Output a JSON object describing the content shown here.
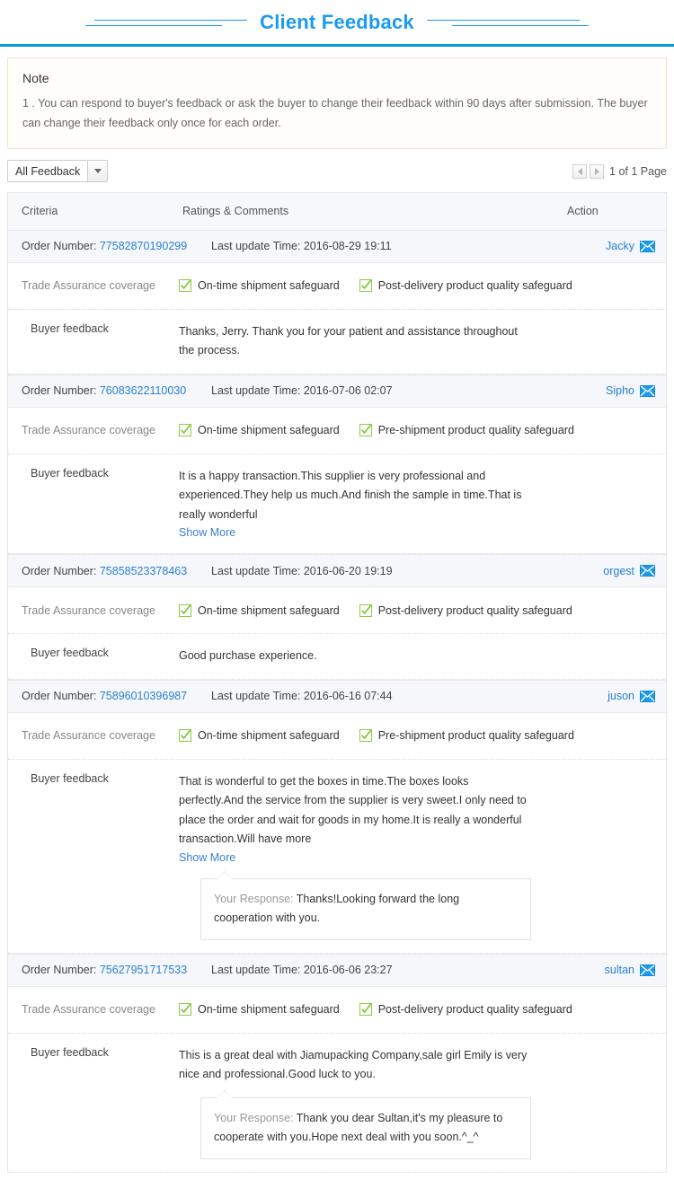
{
  "header": {
    "title": "Client Feedback",
    "accent_color": "#1a9bf0"
  },
  "note": {
    "title": "Note",
    "text": "1 . You can respond to buyer's feedback or ask the buyer to change their feedback within 90 days after submission. The buyer can change their feedback only once for each order."
  },
  "toolbar": {
    "filter_selected": "All Feedback",
    "filter_icon": "chevron-down-icon",
    "prev_icon": "triangle-left-icon",
    "next_icon": "triangle-right-icon",
    "page_label": "1 of 1 Page"
  },
  "table": {
    "columns": {
      "criteria": "Criteria",
      "ratings": "Ratings & Comments",
      "action": "Action"
    },
    "row_labels": {
      "order_number": "Order Number:",
      "last_update": "Last update Time:",
      "trade_assurance": "Trade Assurance coverage",
      "buyer_feedback": "Buyer feedback",
      "show_more": "Show More",
      "your_response": "Your Response:"
    },
    "icons": {
      "coverage": "green-check-box-icon",
      "contact": "envelope-icon"
    }
  },
  "feedback": [
    {
      "order_number": "77582870190299",
      "last_update": "2016-08-29 19:11",
      "buyer": "Jacky",
      "coverage": [
        "On-time shipment safeguard",
        "Post-delivery product quality safeguard"
      ],
      "comment": "Thanks, Jerry. Thank you for your patient and assistance throughout the process.",
      "show_more": false,
      "response": null
    },
    {
      "order_number": "76083622110030",
      "last_update": "2016-07-06 02:07",
      "buyer": "Sipho",
      "coverage": [
        "On-time shipment safeguard",
        "Pre-shipment product quality safeguard"
      ],
      "comment": "It is a happy transaction.This supplier is very professional and experienced.They help us much.And finish the sample in time.That is really wonderful",
      "show_more": true,
      "response": null
    },
    {
      "order_number": "75858523378463",
      "last_update": "2016-06-20 19:19",
      "buyer": "orgest",
      "coverage": [
        "On-time shipment safeguard",
        "Post-delivery product quality safeguard"
      ],
      "comment": "Good purchase experience.",
      "show_more": false,
      "response": null
    },
    {
      "order_number": "75896010396987",
      "last_update": "2016-06-16 07:44",
      "buyer": "juson",
      "coverage": [
        "On-time shipment safeguard",
        "Pre-shipment product quality safeguard"
      ],
      "comment": "That is wonderful to get the boxes in time.The boxes looks perfectly.And the service from the supplier is very sweet.I only need to place the order and wait for goods in my home.It is really a wonderful transaction.Will have more",
      "show_more": true,
      "response": "Thanks!Looking forward the long cooperation with you."
    },
    {
      "order_number": "75627951717533",
      "last_update": "2016-06-06 23:27",
      "buyer": "sultan",
      "coverage": [
        "On-time shipment safeguard",
        "Post-delivery product quality safeguard"
      ],
      "comment": "This is a great deal with Jiamupacking Company,sale girl Emily is very nice and professional.Good luck to you.",
      "show_more": false,
      "response": "Thank you dear Sultan,it's my pleasure to cooperate with you.Hope next deal with you soon.^_^"
    }
  ]
}
